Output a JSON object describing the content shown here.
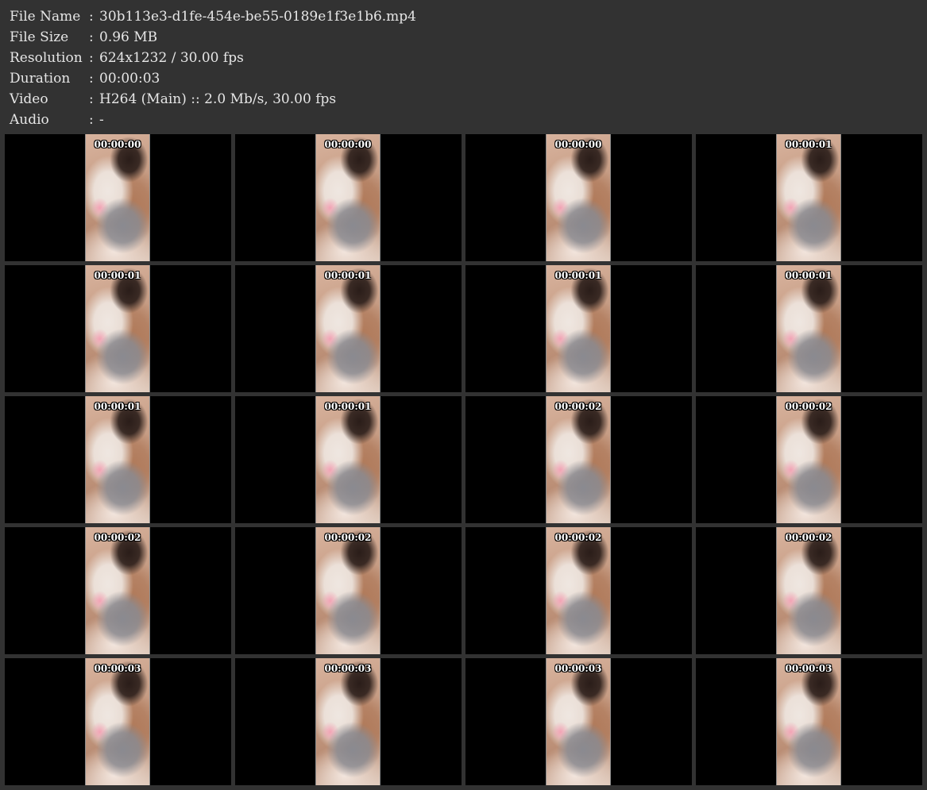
{
  "info": {
    "rows": [
      {
        "label": "File Name",
        "value": "30b113e3-d1fe-454e-be55-0189e1f3e1b6.mp4"
      },
      {
        "label": "File Size",
        "value": "0.96 MB"
      },
      {
        "label": "Resolution",
        "value": "624x1232 / 30.00 fps"
      },
      {
        "label": "Duration",
        "value": "00:00:03"
      },
      {
        "label": "Video",
        "value": "H264 (Main) :: 2.0 Mb/s, 30.00 fps"
      },
      {
        "label": "Audio",
        "value": "-"
      }
    ],
    "separator": ":"
  },
  "thumbnails": [
    "00:00:00",
    "00:00:00",
    "00:00:00",
    "00:00:01",
    "00:00:01",
    "00:00:01",
    "00:00:01",
    "00:00:01",
    "00:00:01",
    "00:00:01",
    "00:00:02",
    "00:00:02",
    "00:00:02",
    "00:00:02",
    "00:00:02",
    "00:00:02",
    "00:00:03",
    "00:00:03",
    "00:00:03",
    "00:00:03"
  ],
  "colors": {
    "background": "#323232",
    "cell": "#000000",
    "text": "#e6e6e6"
  }
}
